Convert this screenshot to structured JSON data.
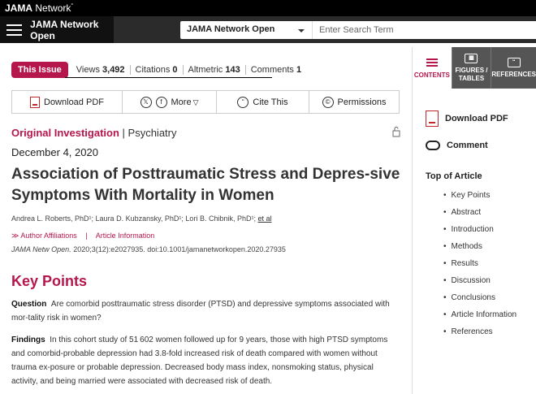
{
  "topbar": {
    "brand_bold": "JAMA",
    "brand_rest": " Network",
    "brand_mark": "°"
  },
  "nav": {
    "journal_name": "JAMA Network Open",
    "select_value": "JAMA Network Open",
    "search_placeholder": "Enter Search Term"
  },
  "metrics": {
    "badge": "This Issue",
    "items": [
      {
        "label": "Views",
        "value": "3,492"
      },
      {
        "label": "Citations",
        "value": "0"
      },
      {
        "label": "Altmetric",
        "value": "143"
      },
      {
        "label": "Comments",
        "value": "1"
      }
    ]
  },
  "toolbar": {
    "download_pdf": "Download PDF",
    "twitter": "𝕏",
    "facebook": "f",
    "more": "More",
    "more_caret": "▽",
    "cite": "Cite This",
    "cite_icon": "“",
    "permissions": "Permissions",
    "permissions_icon": "©"
  },
  "article": {
    "type": "Original Investigation",
    "separator": " | ",
    "specialty": "Psychiatry",
    "date": "December 4, 2020",
    "title": "Association of Posttraumatic Stress and Depres-sive Symptoms With Mortality in Women",
    "authors": "Andrea L. Roberts, PhD¹; Laura D. Kubzansky, PhD¹; Lori B. Chibnik, PhD¹; ",
    "et_al": "et al",
    "affiliations_link": "≫ Author Affiliations",
    "affil_sep": "|",
    "article_info_link": "Article Information",
    "citation_journal": "JAMA Netw Open.",
    "citation_rest": " 2020;3(12):e2027935. doi:10.1001/jamanetworkopen.2020.27935"
  },
  "key_points": {
    "title": "Key Points",
    "question_label": "Question",
    "question": "Are comorbid posttraumatic stress disorder (PTSD) and depressive symptoms associated with mor-tality risk in women?",
    "findings_label": "Findings",
    "findings": "In this cohort study of 51 602 women followed up for 9 years, those with high PTSD symptoms and comorbid-probable depression had 3.8-fold increased risk of death compared with women without trauma ex-posure or probable depression. Decreased body mass index, nonsmoking status, physical activity, and being married were associated with decreased risk of death."
  },
  "sidebar": {
    "tabs": [
      "CONTENTS",
      "FIGURES / TABLES",
      "REFERENCES"
    ],
    "download_pdf": "Download PDF",
    "comment": "Comment",
    "toc_title": "Top of Article",
    "toc": [
      "Key Points",
      "Abstract",
      "Introduction",
      "Methods",
      "Results",
      "Discussion",
      "Conclusions",
      "Article Information",
      "References"
    ]
  },
  "colors": {
    "accent": "#b5174c",
    "pdf_red": "#c0282d",
    "nav_dark": "#2b2b2b"
  },
  "icons": [
    "hamburger-icon",
    "chevron-down-icon",
    "pdf-icon",
    "twitter-icon",
    "facebook-icon",
    "quote-icon",
    "copyright-icon",
    "unlock-icon",
    "comment-icon",
    "list-icon",
    "figures-icon",
    "references-icon"
  ]
}
